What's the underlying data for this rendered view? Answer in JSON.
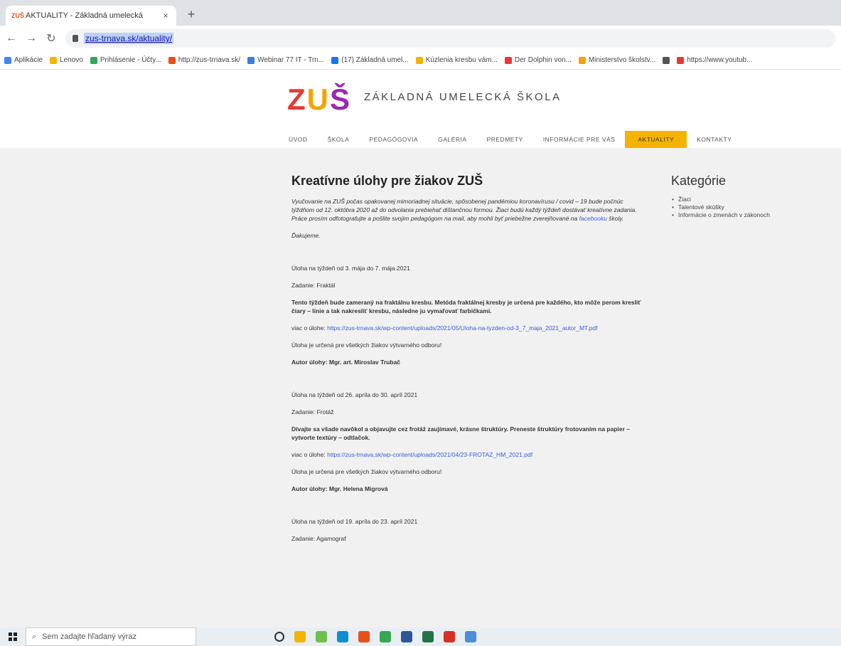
{
  "browser": {
    "tab_title": "AKTUALITY - Základná umelecká",
    "tab_favicon": "zus-favicon",
    "new_tab_label": "+",
    "close_label": "×",
    "url": "zus-trnava.sk/aktuality/",
    "bookmarks": [
      {
        "label": "Aplikácie",
        "color": "#4285f4"
      },
      {
        "label": "Lenovo",
        "color": "#f4b400"
      },
      {
        "label": "Prihlásenie - Účty...",
        "color": "#34a853"
      },
      {
        "label": "http://zus-trnava.sk/",
        "color": "#e8501a"
      },
      {
        "label": "Webinar 77 IT - Trn...",
        "color": "#3b7dd8"
      },
      {
        "label": "(17) Základná umel...",
        "color": "#1877f2"
      },
      {
        "label": "Kúzlenia kresbu vám...",
        "color": "#f4b400"
      },
      {
        "label": "Der Dolphin von...",
        "color": "#e53935"
      },
      {
        "label": "Ministerstvo školstv...",
        "color": "#f4a300"
      },
      {
        "label": "",
        "color": "#555555"
      },
      {
        "label": "https://www.youtub...",
        "color": "#e53935"
      }
    ]
  },
  "site": {
    "logo": {
      "z": "Z",
      "u": "U",
      "s": "Š"
    },
    "school_name": "ZÁKLADNÁ UMELECKÁ ŠKOLA",
    "nav": [
      {
        "label": "ÚVOD",
        "active": false
      },
      {
        "label": "ŠKOLA",
        "active": false
      },
      {
        "label": "PEDAGÓGOVIA",
        "active": false
      },
      {
        "label": "GALÉRIA",
        "active": false
      },
      {
        "label": "PREDMETY",
        "active": false
      },
      {
        "label": "INFORMÁCIE PRE VÁS",
        "active": false
      },
      {
        "label": "AKTUALITY",
        "active": true
      },
      {
        "label": "KONTAKTY",
        "active": false
      }
    ]
  },
  "article": {
    "title": "Kreatívne úlohy pre žiakov ZUŠ",
    "intro_text": "Vyučovanie na ZUŠ počas opakovanej mimoriadnej situácie, spôsobenej pandémiou koronavírusu / covid – 19 bude počnúc týždňom od 12. októbra 2020 až do odvolania prebiehať dištančnou formou. Žiaci budú každý týždeň dostávať kreatívne zadania. Práce prosím odfotografujte a pošlite svojim pedagógom na mail, aby mohli byť priebežne zverejňované na ",
    "intro_link": "facebooku",
    "intro_end": " školy.",
    "thanks": "Ďakujeme.",
    "tasks": [
      {
        "week": "Úloha na týždeň od 3. mája do 7. mája 2021",
        "assignment": "Zadanie: Fraktál",
        "description": "Tento týždeň bude zameraný na fraktálnu kresbu. Metóda fraktálnej kresby je určená pre každého, kto môže perom kresliť čiary – línie a tak nakresliť kresbu, následne ju vymaľovať farbičkami.",
        "more_label": "viac o úlohe: ",
        "more_link": "https://zus-trnava.sk/wp-content/uploads/2021/05/Uloha-na-tyzden-od-3_7_maja_2021_autor_MT.pdf",
        "audience": "Úloha je určená pre všetkých žiakov výtvarného odboru!",
        "author": "Autor úlohy: Mgr. art. Miroslav Trubač"
      },
      {
        "week": "Úloha na týždeň od 26. apríla do 30. apríl 2021",
        "assignment": "Zadanie: Frotáž",
        "description": "Dívajte sa všade navôkol a objavujte cez frotáž zaujímavé, krásne štruktúry. Preneste štruktúry frotovaním na papier – vytvorte textúry – odtlačok.",
        "more_label": "viac o úlohe: ",
        "more_link": "https://zus-trnava.sk/wp-content/uploads/2021/04/23-FROTAZ_HM_2021.pdf",
        "audience": "Úloha je určená pre všetkých žiakov výtvarného odboru!",
        "author": "Autor úlohy: Mgr. Helena Migrová"
      },
      {
        "week": "Úloha na týždeň od 19. apríla do 23. apríl 2021",
        "assignment": "Zadanie: Agamograf"
      }
    ]
  },
  "sidebar": {
    "title": "Kategórie",
    "items": [
      "Žiaci",
      "Talentové skúšky",
      "Informácie o zmenách v zákonoch"
    ]
  },
  "taskbar": {
    "search_placeholder": "Sem zadajte hľadaný výraz",
    "apps": [
      {
        "name": "cortana-icon",
        "color": "#333333"
      },
      {
        "name": "file-explorer-icon",
        "color": "#f4b400"
      },
      {
        "name": "photos-icon",
        "color": "#6fbf4e"
      },
      {
        "name": "edge-icon",
        "color": "#0f8fd3"
      },
      {
        "name": "paint-icon",
        "color": "#e8501a"
      },
      {
        "name": "chrome-icon",
        "color": "#34a853"
      },
      {
        "name": "word-icon",
        "color": "#2b579a"
      },
      {
        "name": "excel-icon",
        "color": "#217346"
      },
      {
        "name": "acrobat-icon",
        "color": "#d93025"
      },
      {
        "name": "notepad-icon",
        "color": "#4a8fd8"
      }
    ]
  }
}
